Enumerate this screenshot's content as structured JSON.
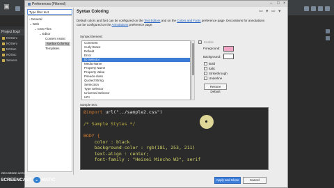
{
  "eclipse": {
    "project_tab": "Project Expl",
    "projects": [
      "NOServ",
      "NOServ",
      "NOSoc",
      "NOSoc",
      "Servers"
    ],
    "bottom_code": [
      "18",
      "body",
      "{"
    ]
  },
  "dialog": {
    "title": "Preferences (Filtered)",
    "filter_value": "Type filter text",
    "tree": [
      {
        "label": "General",
        "arrow": "›"
      },
      {
        "label": "Web",
        "arrow": "⌄"
      },
      {
        "label": "CSS Files",
        "arrow": "⌄"
      },
      {
        "label": "Editor",
        "arrow": "⌄"
      },
      {
        "label": "Content Assist",
        "arrow": ""
      },
      {
        "label": "Syntax Coloring",
        "arrow": ""
      },
      {
        "label": "Templates",
        "arrow": ""
      }
    ],
    "page_title": "Syntax Coloring",
    "desc_line1_pre": "Default colors and font can be configured on the ",
    "desc_link1": "Text Editors",
    "desc_line1_mid": " and on the ",
    "desc_link2": "Colors and Fonts",
    "desc_line1_post": " preference page. Decorations for annotations",
    "desc_line2_pre": "can be configured on the ",
    "desc_link3": "Annotations",
    "desc_line2_post": " preference page.",
    "syntax_element_label": "Syntax Element:",
    "elements": [
      "Comment",
      "Curly Brace",
      "Default",
      "Error",
      "ID Selector",
      "Media Name",
      "Property Name",
      "Property Value",
      "Pseudo-class",
      "Quoted String",
      "Semicolon",
      "Type Selector",
      "Universal Selector",
      "URI"
    ],
    "selected_element": "ID Selector",
    "enable_label": "Enable",
    "foreground_label": "Foreground:",
    "background_label": "Background:",
    "foreground_color": "#f2a7c6",
    "background_color": "#ffffff",
    "checkboxes": [
      "Bold",
      "Italic",
      "Strikethrough",
      "Underline"
    ],
    "restore_label": "Restore Default",
    "sample_label": "Sample text:",
    "sample": {
      "line1_kw": "@import",
      "line1_str": " url(\"../sample2.css\")",
      "line2": "/* Sample Styles */",
      "line3": "BODY {",
      "line4": "    color : black",
      "line5": "    background-color : rgb(181, 253, 211)",
      "line6": "    text-align : center;",
      "line7": "    font-family : \"Heisei Mincho W3\", serif"
    },
    "buttons": {
      "apply_close": "Apply and Close",
      "cancel": "Cancel"
    }
  },
  "watermark": {
    "recorded": "RECORDED WITH",
    "brand": "SCREENCAST",
    "suffix": "MATIC"
  }
}
